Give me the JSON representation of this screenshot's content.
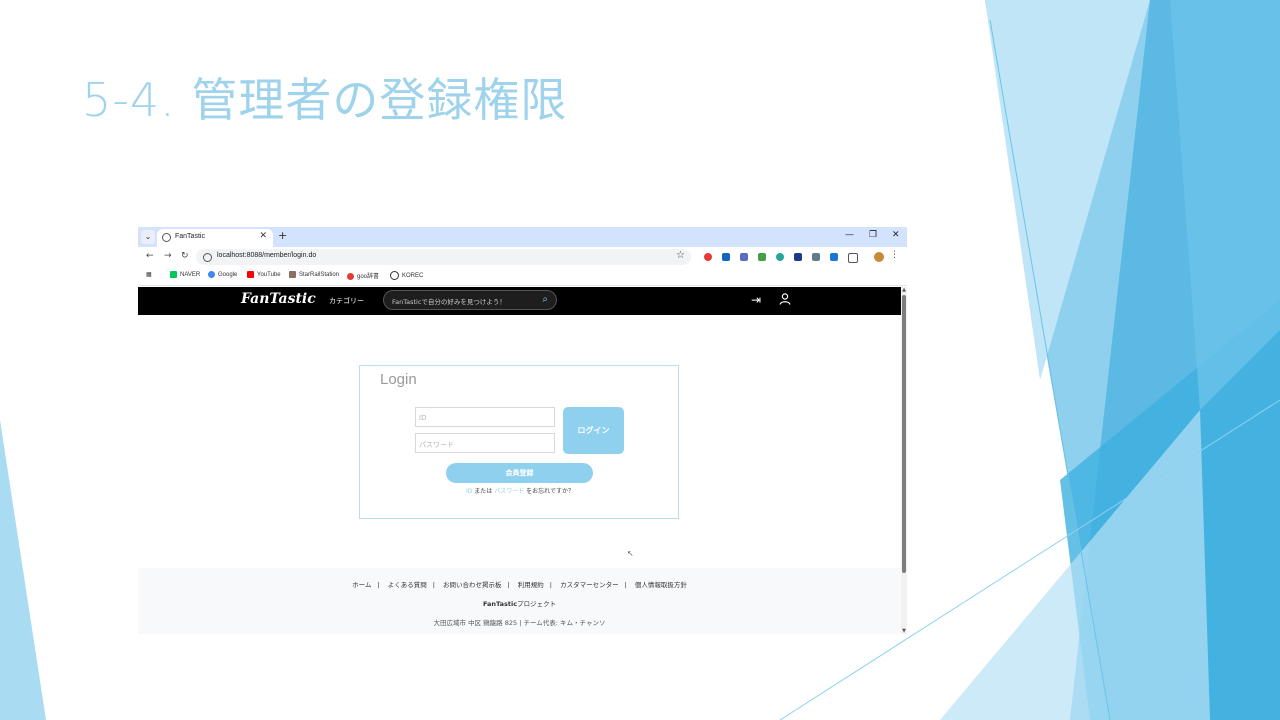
{
  "slide": {
    "title": "5-4. 管理者の登録権限"
  },
  "browser": {
    "tab_title": "FanTastic",
    "tab_close": "✕",
    "new_tab": "+",
    "tab_list": "⌄",
    "window_min": "—",
    "window_restore": "❐",
    "window_close": "✕",
    "nav_back": "←",
    "nav_forward": "→",
    "nav_reload": "↻",
    "url": "localhost:8088/member/login.do",
    "bookmark_star": "☆",
    "menu": "⋮",
    "bookmarks": [
      "NAVER",
      "Google",
      "YouTube",
      "StarRailStation",
      "goo辞書",
      "KOREC"
    ]
  },
  "site": {
    "logo": "FanTastic",
    "category": "カテゴリー",
    "search_placeholder": "FanTasticで自分の好みを見つけよう！",
    "icons": [
      "search-icon",
      "login-icon",
      "user-icon"
    ]
  },
  "login": {
    "title": "Login",
    "id_placeholder": "ID",
    "password_placeholder": "パスワード",
    "login_button": "ログイン",
    "signup_button": "会員登録",
    "forgot_id": "ID",
    "forgot_or": "または",
    "forgot_password": "パスワード",
    "forgot_suffix": "をお忘れですか？"
  },
  "footer": {
    "links": [
      "ホーム",
      "よくある質問",
      "お問い合わせ掲示板",
      "利用規約",
      "カスタマーセンター",
      "個人情報取扱方針"
    ],
    "brand_bold": "FanTastic",
    "brand_rest": "プロジェクト",
    "address": "大田広域市 中区 鶏龍路 825 | チーム代表: キム・チャンソ"
  },
  "colors": {
    "accent": "#8fd0ef",
    "title": "#9fd3ec",
    "tabbar": "#d3e3fd",
    "header": "#000000"
  }
}
